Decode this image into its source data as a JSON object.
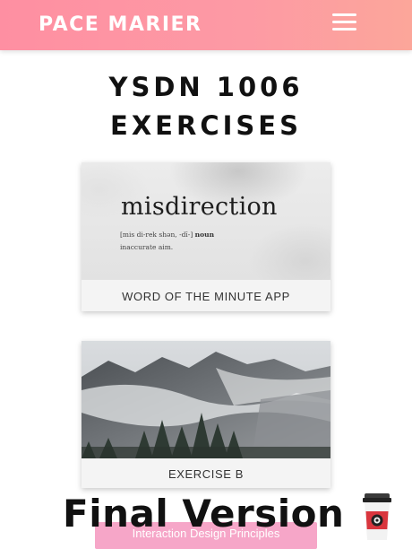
{
  "header": {
    "brand": "PACE MARIER",
    "menu_icon": "hamburger-menu-icon",
    "gradient": [
      "#fe8fa2",
      "#fca69a"
    ]
  },
  "page": {
    "title_line1": "YSDN 1006",
    "title_line2": "EXERCISES"
  },
  "cards": [
    {
      "caption": "WORD OF THE MINUTE APP",
      "thumbnail": {
        "word": "misdirection",
        "pronunciation": "[mis di-rek shən, -dī-]",
        "part_of_speech": "noun",
        "definition": "inaccurate aim."
      }
    },
    {
      "caption": "EXERCISE B",
      "thumbnail": {
        "subject": "misty mountain with pine trees"
      }
    }
  ],
  "overlay": {
    "final_label": "Final Version",
    "button_label": "Interaction Design Principles",
    "button_color": "#f6a6c8",
    "cup_icon": "coffee-cup-icon"
  }
}
